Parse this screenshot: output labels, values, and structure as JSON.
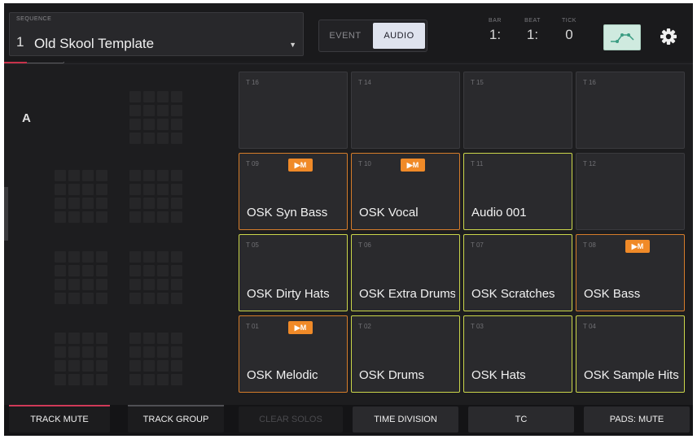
{
  "sequence": {
    "label": "SEQUENCE",
    "number": "1",
    "name": "Old Skool Template"
  },
  "mode": {
    "event_label": "EVENT",
    "audio_label": "AUDIO",
    "selected": "AUDIO"
  },
  "position": {
    "bar_label": "BAR",
    "bar_value": "1:",
    "beat_label": "BEAT",
    "beat_value": "1:",
    "tick_label": "TICK",
    "tick_value": "0"
  },
  "icons": {
    "automation": "automation-icon",
    "settings": "gear-icon"
  },
  "bank": {
    "label": "A"
  },
  "mini_grid_colors": [
    "#8a8a8e",
    "#8a8a8e",
    "#8a8a8e",
    "#8a8a8e",
    "#f08a28",
    "#f08a28",
    "#8a8a8e",
    "#f08a28",
    "#f7e84a",
    "#f7e84a",
    "#f7e84a",
    "#f7e84a",
    "#f08a28",
    "#f7e84a",
    "#f7e84a",
    "#f08a28"
  ],
  "pads": [
    {
      "num": "T 16",
      "name": "",
      "color": "none",
      "mute": false
    },
    {
      "num": "T 14",
      "name": "",
      "color": "none",
      "mute": false
    },
    {
      "num": "T 15",
      "name": "",
      "color": "none",
      "mute": false
    },
    {
      "num": "T 16",
      "name": "",
      "color": "none",
      "mute": false
    },
    {
      "num": "T 09",
      "name": "OSK Syn Bass",
      "color": "orange",
      "mute": true
    },
    {
      "num": "T 10",
      "name": "OSK Vocal",
      "color": "orange",
      "mute": true
    },
    {
      "num": "T 11",
      "name": "Audio 001",
      "color": "yellow",
      "mute": false
    },
    {
      "num": "T 12",
      "name": "",
      "color": "none",
      "mute": false
    },
    {
      "num": "T 05",
      "name": "OSK Dirty Hats",
      "color": "yellow",
      "mute": false
    },
    {
      "num": "T 06",
      "name": "OSK Extra Drums",
      "color": "yellow",
      "mute": false
    },
    {
      "num": "T 07",
      "name": "OSK Scratches",
      "color": "yellow",
      "mute": false
    },
    {
      "num": "T 08",
      "name": "OSK Bass",
      "color": "orange",
      "mute": true
    },
    {
      "num": "T 01",
      "name": "OSK Melodic",
      "color": "orange",
      "mute": true
    },
    {
      "num": "T 02",
      "name": "OSK Drums",
      "color": "yellow",
      "mute": false
    },
    {
      "num": "T 03",
      "name": "OSK Hats",
      "color": "yellow",
      "mute": false
    },
    {
      "num": "T 04",
      "name": "OSK Sample Hits",
      "color": "yellow",
      "mute": false
    }
  ],
  "mute_badge": "▶M",
  "bottom": {
    "track_mute": "TRACK MUTE",
    "track_group": "TRACK GROUP",
    "clear_solos": "CLEAR SOLOS",
    "time_division": "TIME DIVISION",
    "tc": "TC",
    "pads_mute": "PADS: MUTE"
  }
}
